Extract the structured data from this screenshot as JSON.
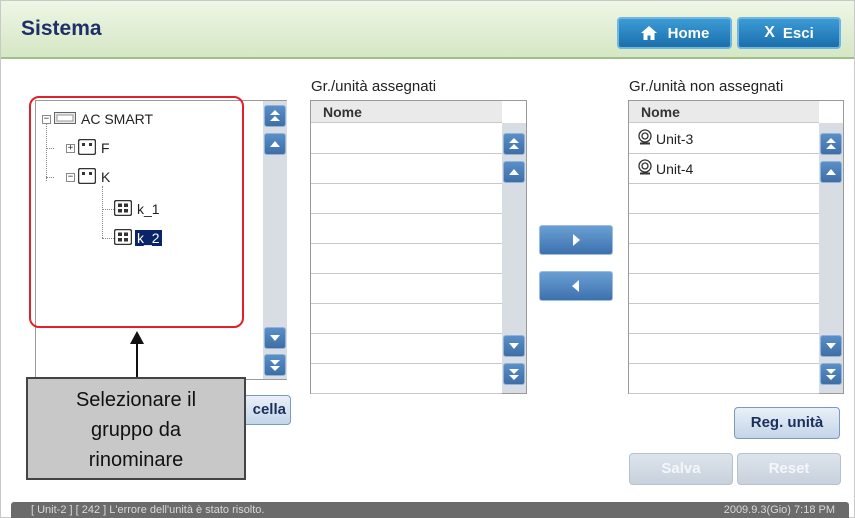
{
  "header": {
    "title": "Sistema",
    "home_label": "Home",
    "exit_icon": "X",
    "exit_label": "Esci"
  },
  "tree": {
    "nodes": [
      {
        "label": "AC SMART",
        "expander": "−",
        "icon": "ac-smart-icon"
      },
      {
        "label": "F",
        "expander": "+",
        "icon": "group-icon"
      },
      {
        "label": "K",
        "expander": "−",
        "icon": "group-icon"
      },
      {
        "label": "k_1",
        "icon": "unit-grid-icon"
      },
      {
        "label": "k_2",
        "icon": "unit-grid-icon",
        "selected": true
      }
    ],
    "partial_button_label": "cella"
  },
  "assigned": {
    "title": "Gr./unità assegnati",
    "header": "Nome",
    "rows": []
  },
  "unassigned": {
    "title": "Gr./unità non assegnati",
    "header": "Nome",
    "rows": [
      "Unit-3",
      "Unit-4"
    ]
  },
  "buttons": {
    "reg_unit": "Reg. unità",
    "save": "Salva",
    "reset": "Reset"
  },
  "callout": {
    "line1": "Selezionare il",
    "line2": "gruppo da",
    "line3": "rinominare"
  },
  "status": {
    "message": "[ Unit-2 ] [ 242 ] L'errore dell'unità è stato risolto.",
    "datetime": "2009.9.3(Gio)  7:18 PM"
  },
  "colors": {
    "accent": "#1b6fab",
    "title": "#1f2f67",
    "highlight": "#e0202a",
    "selected": "#0a246a"
  }
}
